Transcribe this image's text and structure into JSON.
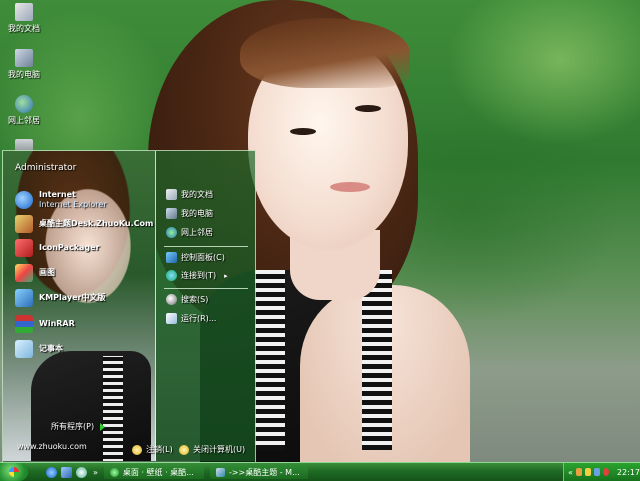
{
  "desktop": {
    "icons": [
      {
        "label": "我的文档",
        "icon": "documents-icon"
      },
      {
        "label": "我的电脑",
        "icon": "computer-icon"
      },
      {
        "label": "网上邻居",
        "icon": "network-icon"
      },
      {
        "label": "",
        "icon": "recycle-bin-icon"
      }
    ]
  },
  "start_menu": {
    "user": "Administrator",
    "pinned": [
      {
        "label": "Internet",
        "sublabel": "Internet Explorer",
        "icon": "internet-explorer-icon"
      },
      {
        "label": "桌酷主题Desk.ZhuoKu.Com",
        "icon": "zhuoku-theme-icon"
      },
      {
        "label": "IconPackager",
        "icon": "iconpackager-icon"
      },
      {
        "label": "画图",
        "icon": "paint-icon"
      },
      {
        "label": "KMPlayer中文版",
        "icon": "kmplayer-icon"
      },
      {
        "label": "WinRAR",
        "icon": "winrar-icon"
      },
      {
        "label": "记事本",
        "icon": "notepad-icon"
      }
    ],
    "all_programs": "所有程序(P)",
    "website": "www.zhuoku.com",
    "right": [
      {
        "label": "我的文档",
        "icon": "documents-icon"
      },
      {
        "label": "我的电脑",
        "icon": "computer-icon"
      },
      {
        "label": "网上邻居",
        "icon": "network-icon"
      },
      {
        "label": "控制面板(C)",
        "icon": "control-panel-icon"
      },
      {
        "label": "连接到(T)",
        "icon": "connect-to-icon",
        "arrow": "▸"
      },
      {
        "label": "搜索(S)",
        "icon": "search-icon"
      },
      {
        "label": "运行(R)...",
        "icon": "run-icon"
      }
    ],
    "logoff": "注销(L)",
    "shutdown": "关闭计算机(U)"
  },
  "taskbar": {
    "arrow": "»",
    "tasks": [
      {
        "label": "桌面 · 壁纸 · 桌酷...",
        "icon": "browser-window-icon"
      },
      {
        "label": "->>桌酷主题 - M...",
        "icon": "ie-window-icon"
      }
    ],
    "tray_arrow": "«",
    "clock": "22:17"
  },
  "colors": {
    "taskbar": "#1f6b24",
    "accent": "#3a8f3a",
    "menu_border": "#dcffdc"
  }
}
